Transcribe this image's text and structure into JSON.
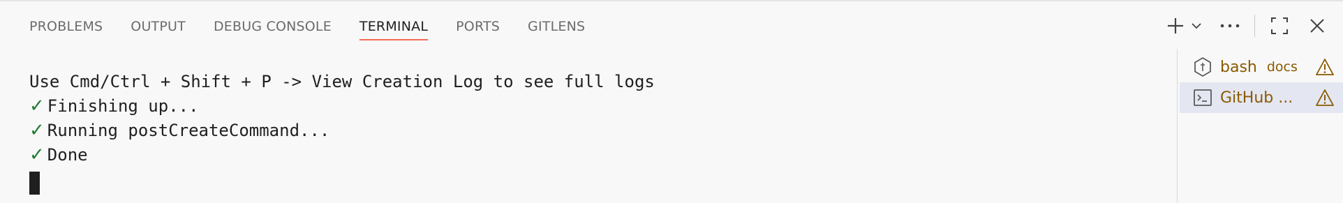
{
  "panel": {
    "tabs": [
      {
        "label": "PROBLEMS",
        "active": false
      },
      {
        "label": "OUTPUT",
        "active": false
      },
      {
        "label": "DEBUG CONSOLE",
        "active": false
      },
      {
        "label": "TERMINAL",
        "active": true
      },
      {
        "label": "PORTS",
        "active": false
      },
      {
        "label": "GITLENS",
        "active": false
      }
    ],
    "toolbar": {
      "icons": [
        "plus-icon",
        "chevron-down-icon",
        "more-icon",
        "maximize-icon",
        "close-icon"
      ]
    }
  },
  "terminal": {
    "lines": [
      {
        "check": false,
        "text": "Use Cmd/Ctrl + Shift + P -> View Creation Log to see full logs"
      },
      {
        "check": true,
        "text": "Finishing up..."
      },
      {
        "check": true,
        "text": "Running postCreateCommand..."
      },
      {
        "check": true,
        "text": "Done"
      }
    ],
    "check_glyph": "✓"
  },
  "terminal_list": [
    {
      "label": "bash",
      "description": "docs",
      "icon": "node-hexagon-icon",
      "warning": true,
      "selected": false
    },
    {
      "label": "GitHub ...",
      "description": "",
      "icon": "terminal-icon",
      "warning": true,
      "selected": true
    }
  ],
  "colors": {
    "active_tab_underline": "#f26a54",
    "check": "#1e7b34",
    "warning": "#8a5a00",
    "selected_row": "#e4e6f1"
  }
}
